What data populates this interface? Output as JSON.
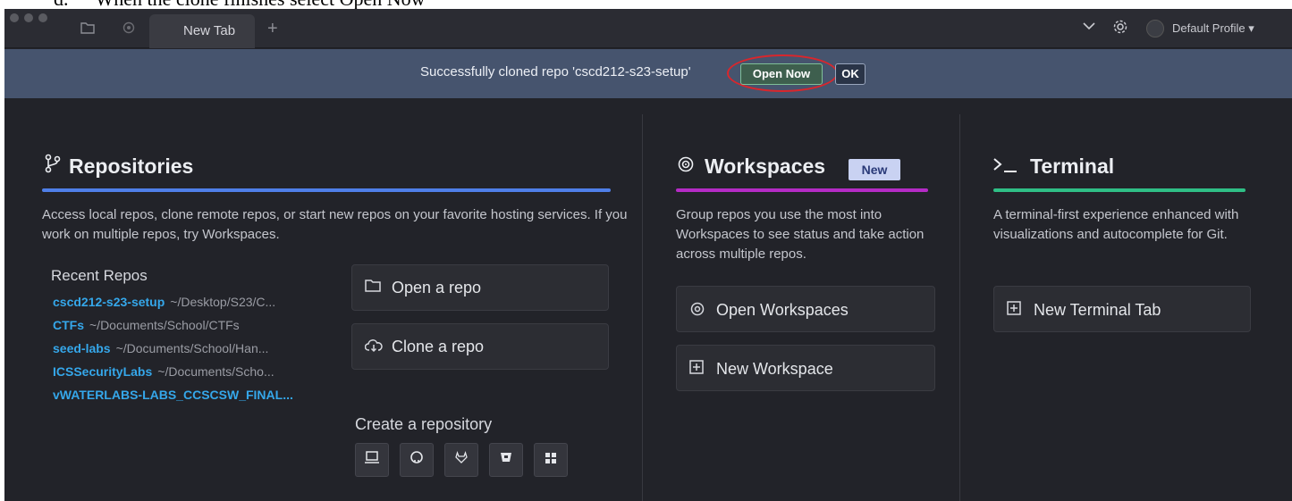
{
  "caption": {
    "marker": "d.",
    "text": "When the clone finishes select Open Now"
  },
  "titlebar": {
    "tab_label": "New Tab",
    "add_tab": "+",
    "profile_label": "Default Profile ▾"
  },
  "banner": {
    "message": "Successfully cloned repo 'cscd212-s23-setup'",
    "open_now_label": "Open Now",
    "ok_label": "OK"
  },
  "repositories": {
    "title": "Repositories",
    "accent_color": "#4f7fe8",
    "description": "Access local repos, clone remote repos, or start new repos on your favorite hosting services. If you work on multiple repos, try Workspaces.",
    "recent_title": "Recent Repos",
    "recent": [
      {
        "name": "cscd212-s23-setup",
        "path": "~/Desktop/S23/C..."
      },
      {
        "name": "CTFs",
        "path": "~/Documents/School/CTFs"
      },
      {
        "name": "seed-labs",
        "path": "~/Documents/School/Han..."
      },
      {
        "name": "ICSSecurityLabs",
        "path": "~/Documents/Scho..."
      },
      {
        "name": "vWATERLABS-LABS_CCSCSW_FINAL...",
        "path": ""
      }
    ],
    "open_repo_label": "Open a repo",
    "clone_repo_label": "Clone a repo",
    "create_title": "Create a repository",
    "hosts": [
      "local-computer-icon",
      "github-icon",
      "gitlab-icon",
      "bitbucket-icon",
      "azure-devops-icon"
    ]
  },
  "workspaces": {
    "title": "Workspaces",
    "badge": "New",
    "accent_color": "#b52bc6",
    "description": "Group repos you use the most into Workspaces to see status and take action across multiple repos.",
    "open_label": "Open Workspaces",
    "new_label": "New Workspace"
  },
  "terminal": {
    "title": "Terminal",
    "accent_color": "#2fbf86",
    "description": "A terminal-first experience enhanced with visualizations and autocomplete for Git.",
    "new_tab_label": "New Terminal Tab"
  }
}
